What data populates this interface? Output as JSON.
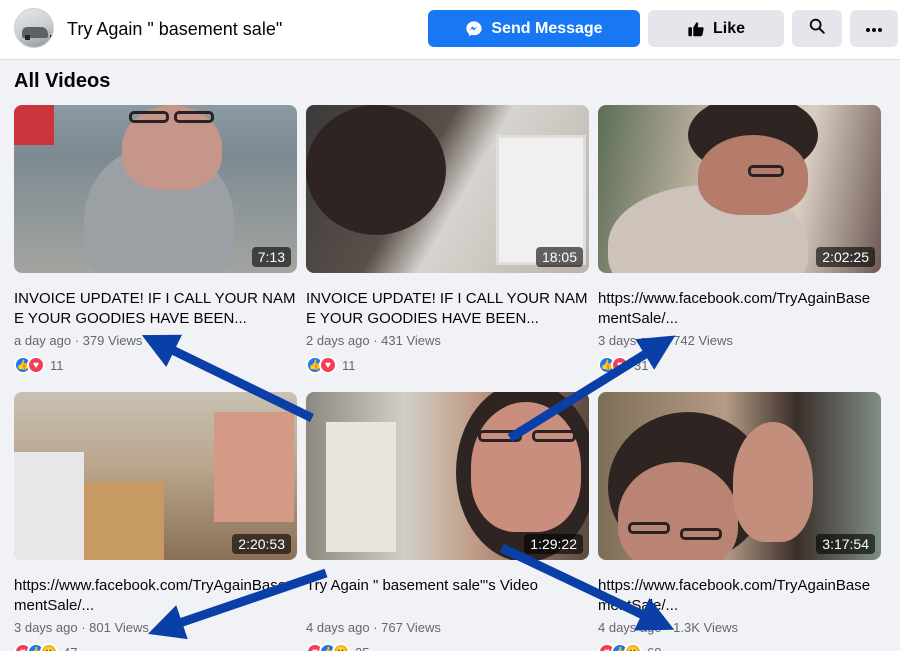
{
  "header": {
    "page_name": "Try Again \" basement sale\"",
    "send_message_label": "Send Message",
    "like_label": "Like"
  },
  "section_title": "All Videos",
  "videos": [
    {
      "title": "INVOICE UPDATE! IF I CALL YOUR NAME YOUR GOODIES HAVE BEEN...",
      "duration": "7:13",
      "age": "a day ago",
      "views": "379 Views",
      "reaction_count": "11",
      "reactions": [
        "like",
        "love"
      ]
    },
    {
      "title": "INVOICE UPDATE! IF I CALL YOUR NAME YOUR GOODIES HAVE BEEN...",
      "duration": "18:05",
      "age": "2 days ago",
      "views": "431 Views",
      "reaction_count": "11",
      "reactions": [
        "like",
        "love"
      ]
    },
    {
      "title": "https://www.facebook.com/TryAgainBasementSale/...",
      "duration": "2:02:25",
      "age": "3 days ago",
      "views": "742 Views",
      "reaction_count": "31",
      "reactions": [
        "like",
        "love"
      ]
    },
    {
      "title": "https://www.facebook.com/TryAgainBasementSale/...",
      "duration": "2:20:53",
      "age": "3 days ago",
      "views": "801 Views",
      "reaction_count": "47",
      "reactions": [
        "love",
        "like",
        "wow"
      ]
    },
    {
      "title": "Try Again \" basement sale\"'s Video",
      "duration": "1:29:22",
      "age": "4 days ago",
      "views": "767 Views",
      "reaction_count": "35",
      "reactions": [
        "love",
        "like",
        "wow"
      ]
    },
    {
      "title": "https://www.facebook.com/TryAgainBasementSale/...",
      "duration": "3:17:54",
      "age": "4 days ago",
      "views": "1.3K Views",
      "reaction_count": "68",
      "reactions": [
        "love",
        "like",
        "wow"
      ]
    }
  ],
  "colors": {
    "primary": "#1877f2",
    "secondary_bg": "#e4e6eb",
    "meta_text": "#65676b",
    "annotation_arrow": "#0b3fa8"
  },
  "icons": [
    "messenger-icon",
    "thumbs-up-icon",
    "search-icon",
    "more-options-icon"
  ]
}
